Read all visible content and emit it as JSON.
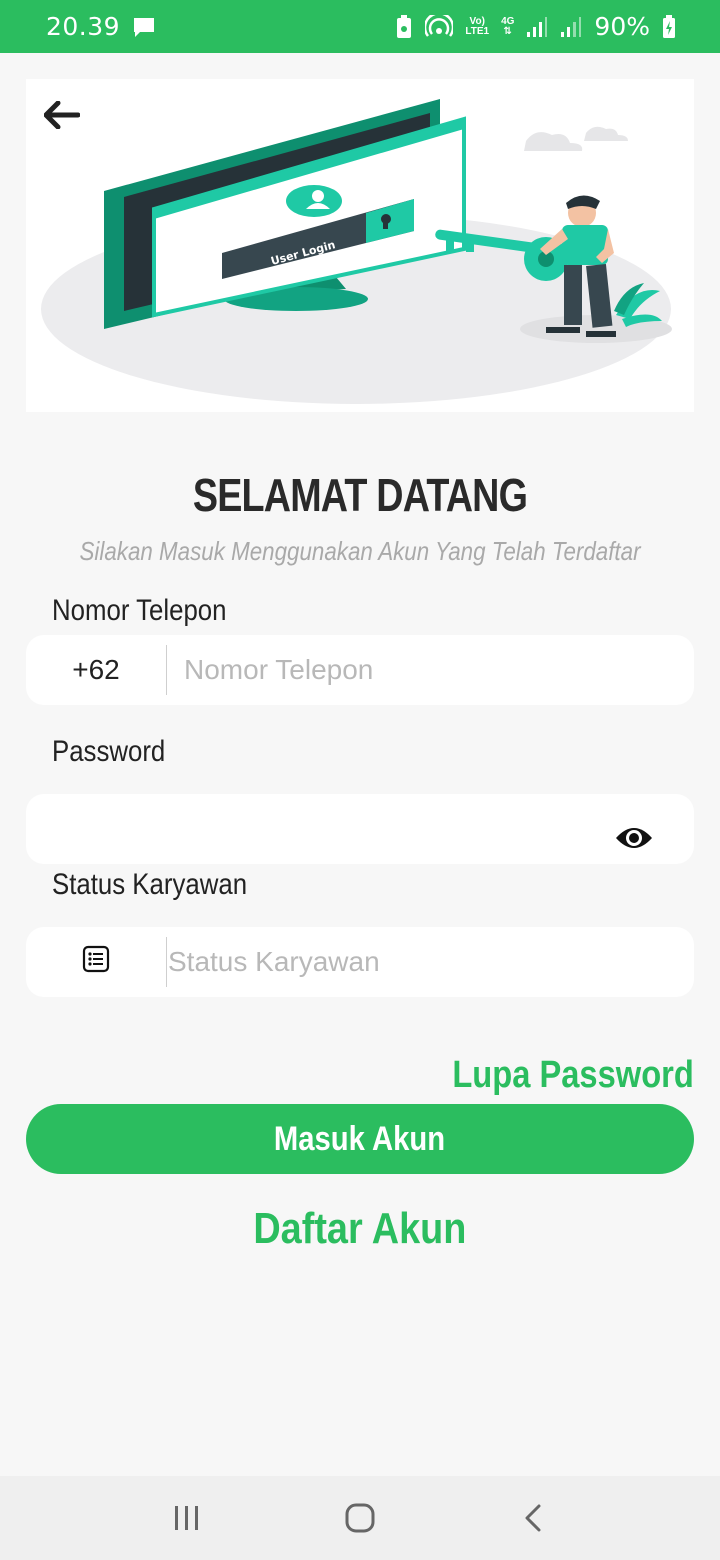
{
  "status_bar": {
    "time": "20.39",
    "network_top": "Vo)",
    "network_bottom": "LTE1",
    "network_type": "4G",
    "battery": "90%",
    "icons": [
      "message-icon",
      "battery-saver-icon",
      "hotspot-icon",
      "volte-icon",
      "signal-icon",
      "signal-icon",
      "battery-charging-icon"
    ]
  },
  "hero": {
    "screen_label": "User Login",
    "back_icon": "arrow-left-icon"
  },
  "welcome": {
    "title": "SELAMAT DATANG",
    "subtitle": "Silakan Masuk Menggunakan Akun Yang Telah Terdaftar"
  },
  "phone": {
    "label": "Nomor Telepon",
    "prefix": "+62",
    "placeholder": "Nomor Telepon",
    "value": ""
  },
  "password": {
    "label": "Password",
    "value": "",
    "toggle_icon": "eye-icon"
  },
  "employee_status": {
    "label": "Status Karyawan",
    "placeholder": "Status Karyawan",
    "icon": "list-icon"
  },
  "actions": {
    "forgot_password": "Lupa Password",
    "login": "Masuk Akun",
    "register": "Daftar Akun"
  },
  "nav": {
    "recents_icon": "recents-icon",
    "home_icon": "home-icon",
    "back_icon": "back-icon"
  },
  "colors": {
    "accent": "#2bbd5f",
    "teal": "#1fc9a5",
    "dark_teal": "#0e8f6f",
    "background": "#f7f7f7"
  }
}
